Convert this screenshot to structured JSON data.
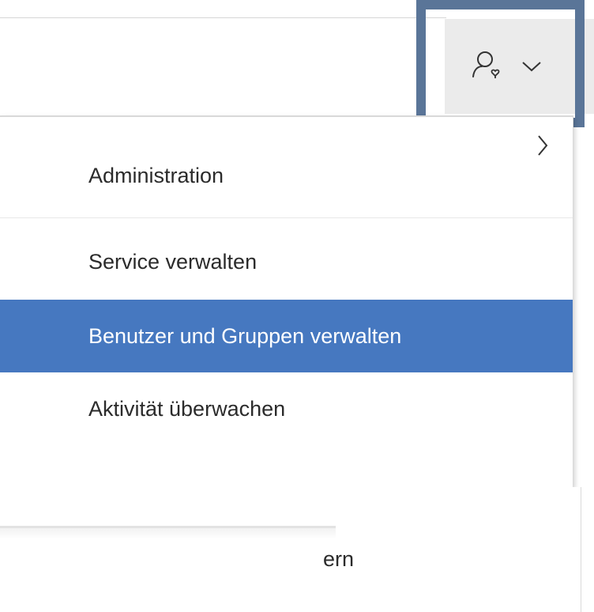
{
  "header": {
    "user_menu": {
      "icon": "user-admin-icon",
      "chevron": "chevron-down-icon"
    }
  },
  "dropdown": {
    "section_header": "Administration",
    "items": [
      {
        "label": "Service verwalten",
        "has_submenu": true,
        "submenu_icon": "chevron-right-icon"
      },
      {
        "label": "Benutzer und Gruppen verwalten",
        "selected": true
      },
      {
        "label": "Aktivität überwachen"
      }
    ]
  },
  "background": {
    "partial_text": "ern"
  },
  "colors": {
    "selected_bg": "#4678c0",
    "selected_text": "#ffffff",
    "button_bg": "#ebebeb",
    "focus_frame": "#5a7598",
    "text": "#2b2b2b"
  }
}
